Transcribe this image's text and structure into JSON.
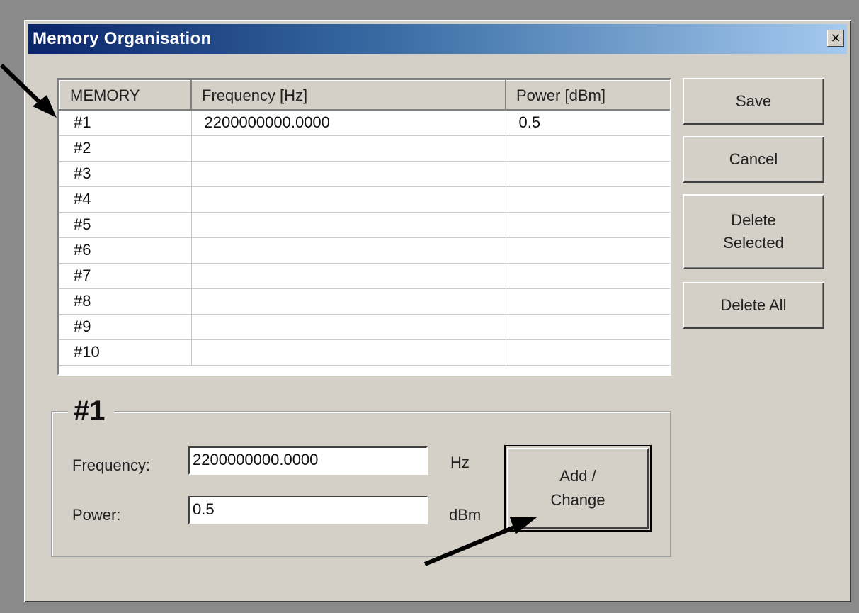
{
  "window": {
    "title": "Memory Organisation",
    "close_glyph": "×"
  },
  "table": {
    "columns": [
      "MEMORY",
      "Frequency [Hz]",
      "Power [dBm]"
    ],
    "rows": [
      [
        "#1",
        "2200000000.0000",
        "0.5"
      ],
      [
        "#2",
        "",
        ""
      ],
      [
        "#3",
        "",
        ""
      ],
      [
        "#4",
        "",
        ""
      ],
      [
        "#5",
        "",
        ""
      ],
      [
        "#6",
        "",
        ""
      ],
      [
        "#7",
        "",
        ""
      ],
      [
        "#8",
        "",
        ""
      ],
      [
        "#9",
        "",
        ""
      ],
      [
        "#10",
        "",
        ""
      ]
    ]
  },
  "side_buttons": {
    "save": "Save",
    "cancel": "Cancel",
    "delete_selected": "Delete\nSelected",
    "delete_all": "Delete All"
  },
  "editor": {
    "group_title": "#1",
    "frequency_label": "Frequency:",
    "frequency_value": "2200000000.0000",
    "frequency_unit": "Hz",
    "power_label": "Power:",
    "power_value": "0.5",
    "power_unit": "dBm",
    "add_change_label": "Add /\nChange"
  }
}
